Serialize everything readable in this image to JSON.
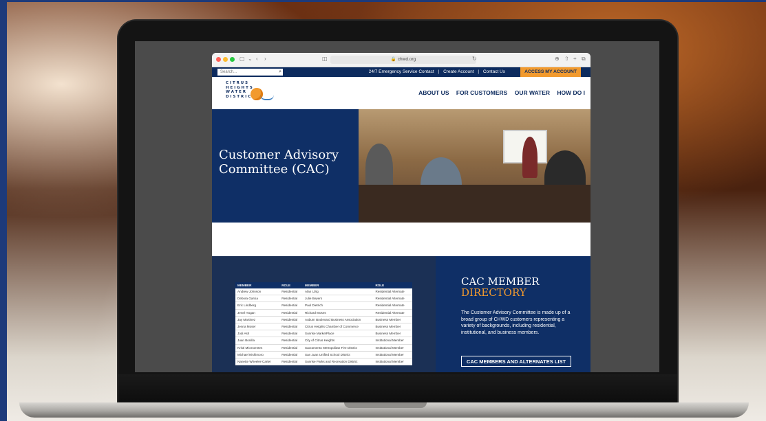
{
  "browser": {
    "url": "chwd.org"
  },
  "utility_bar": {
    "search_placeholder": "Search...",
    "links": [
      "24/7 Emergency Service Contact",
      "|",
      "Create Account",
      "|",
      "Contact Us"
    ],
    "access_button": "ACCESS MY ACCOUNT"
  },
  "logo": {
    "lines": [
      "CITRUS",
      "HEIGHTS",
      "WATER",
      "DISTRICT"
    ]
  },
  "main_nav": [
    "ABOUT US",
    "FOR CUSTOMERS",
    "OUR WATER",
    "HOW DO I"
  ],
  "hero": {
    "title": "Customer Advisory Committee (CAC)"
  },
  "directory": {
    "title_line1": "CAC MEMBER",
    "title_line2": "DIRECTORY",
    "description": "The Customer Advisory Committee is made up of a broad group of CHWD customers representing a variety of backgrounds, including residential, institutional, and business members.",
    "button": "CAC MEMBERS AND ALTERNATES LIST",
    "table": {
      "headers": [
        "MEMBER",
        "ROLE",
        "MEMBER",
        "ROLE"
      ],
      "rows": [
        [
          "Andrew Johnson",
          "Residential",
          "Alan Uzig",
          "Residential Alternate"
        ],
        [
          "Debora Garcia",
          "Residential",
          "Julie Beyers",
          "Residential Alternate"
        ],
        [
          "Eric Lindberg",
          "Residential",
          "Paul Dietrich",
          "Residential Alternate"
        ],
        [
          "Jenel Hogan",
          "Residential",
          "Richard Moses",
          "Residential Alternate"
        ],
        [
          "Jay Martinez",
          "Residential",
          "Auburn Boulevard Business Association",
          "Business Member"
        ],
        [
          "Jenna Moser",
          "Residential",
          "Citrus Heights Chamber of Commerce",
          "Business Member"
        ],
        [
          "Jodi Ash",
          "Residential",
          "Sunrise MarketPlace",
          "Business Member"
        ],
        [
          "Juan Bonilla",
          "Residential",
          "City of Citrus Heights",
          "Institutional Member"
        ],
        [
          "Kristi Micmoentes",
          "Residential",
          "Sacramento Metropolitan Fire District",
          "Institutional Member"
        ],
        [
          "Michael Nishimoro",
          "Residential",
          "San Juan Unified School District",
          "Institutional Member"
        ],
        [
          "Nanette Wheeler-Carter",
          "Residential",
          "Sunrise Parks and Recreation District",
          "Institutional Member"
        ]
      ]
    }
  },
  "colors": {
    "navy": "#0f2f66",
    "orange": "#f29a2e"
  }
}
